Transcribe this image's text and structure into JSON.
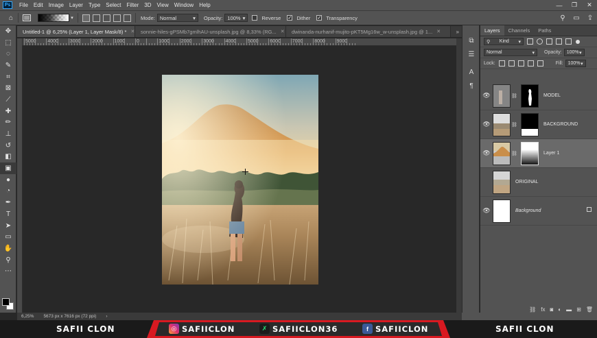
{
  "app": {
    "logo": "Ps"
  },
  "menu": [
    "File",
    "Edit",
    "Image",
    "Layer",
    "Type",
    "Select",
    "Filter",
    "3D",
    "View",
    "Window",
    "Help"
  ],
  "window_controls": [
    "—",
    "❐",
    "✕"
  ],
  "options": {
    "mode_label": "Mode:",
    "mode_value": "Normal",
    "opacity_label": "Opacity:",
    "opacity_value": "100%",
    "reverse_label": "Reverse",
    "dither_label": "Dither",
    "transparency_label": "Transparency"
  },
  "tabs": [
    {
      "label": "Untitled-1 @ 6,25% (Layer 1, Layer Mask/8) *"
    },
    {
      "label": "sonnie-hiles-gPSMb7gmlhAU-unsplash.jpg @ 8,33% (RG..."
    },
    {
      "label": "dwinanda-nurhanif-mujito-pKT5Mg16w_w-unsplash.jpg @ 1..."
    }
  ],
  "ruler": [
    "5000",
    "4500",
    "4000",
    "3500",
    "3000",
    "2500",
    "2000",
    "1500",
    "1000",
    "500",
    "0",
    "500",
    "1000",
    "1500",
    "2000",
    "2500",
    "3000",
    "3500",
    "4000",
    "4500",
    "5000",
    "5500",
    "6000",
    "6500",
    "7000",
    "7500",
    "8000",
    "8500",
    "9000",
    "9500"
  ],
  "layers_panel": {
    "tabs": [
      "Layers",
      "Channels",
      "Paths"
    ],
    "filter_label": "Kind",
    "blend_mode": "Normal",
    "opacity_label": "Opacity:",
    "opacity_value": "100%",
    "lock_label": "Lock:",
    "fill_label": "Fill:",
    "fill_value": "100%",
    "layers": [
      {
        "name": "MODEL",
        "visible": true,
        "has_mask": true,
        "selected": false
      },
      {
        "name": "BACKGROUND",
        "visible": true,
        "has_mask": true,
        "selected": false
      },
      {
        "name": "Layer 1",
        "visible": true,
        "has_mask": true,
        "selected": true
      },
      {
        "name": "ORIGINAL",
        "visible": false,
        "has_mask": false,
        "selected": false
      },
      {
        "name": "Background",
        "visible": true,
        "has_mask": false,
        "selected": false,
        "locked": true
      }
    ],
    "footer_icons": [
      "link-icon",
      "fx-icon",
      "mask-icon",
      "adjustment-icon",
      "folder-icon",
      "new-layer-icon",
      "trash-icon"
    ]
  },
  "status": {
    "zoom": "6,25%",
    "doc_info": "5673 px x 7616 px (72 ppi)"
  },
  "banner": {
    "left_name": "SAFII CLON",
    "instagram": "SAFIICLON",
    "tiktok": "SAFIICLON36",
    "facebook": "SAFIICLON",
    "right_name": "SAFII CLON",
    "accent_color": "#d81921"
  }
}
